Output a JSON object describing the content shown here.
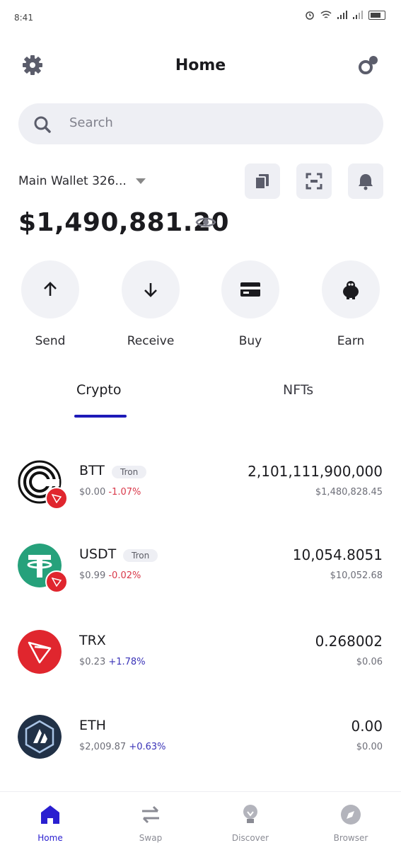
{
  "status_bar": {
    "time": "8:41"
  },
  "header": {
    "title": "Home"
  },
  "search": {
    "placeholder": "Search"
  },
  "wallet": {
    "name": "Main Wallet 326...",
    "balance": "$1,490,881.20"
  },
  "actions": [
    {
      "label": "Send",
      "icon": "arrow-up-icon"
    },
    {
      "label": "Receive",
      "icon": "arrow-down-icon"
    },
    {
      "label": "Buy",
      "icon": "card-icon"
    },
    {
      "label": "Earn",
      "icon": "earn-icon"
    }
  ],
  "tabs": [
    {
      "label": "Crypto",
      "active": true
    },
    {
      "label": "NFTs",
      "active": false
    }
  ],
  "assets": [
    {
      "symbol": "BTT",
      "tag": "Tron",
      "price": "$0.00",
      "change": "-1.07%",
      "amount": "2,101,111,900,000",
      "value": "$1,480,828.45"
    },
    {
      "symbol": "USDT",
      "tag": "Tron",
      "price": "$0.99",
      "change": "-0.02%",
      "amount": "10,054.8051",
      "value": "$10,052.68"
    },
    {
      "symbol": "TRX",
      "tag": "",
      "price": "$0.23",
      "change": "+1.78%",
      "amount": "0.268002",
      "value": "$0.06"
    },
    {
      "symbol": "ETH",
      "tag": "",
      "price": "$2,009.87",
      "change": "+0.63%",
      "amount": "0.00",
      "value": "$0.00"
    }
  ],
  "bottom_nav": [
    {
      "label": "Home",
      "active": true
    },
    {
      "label": "Swap",
      "active": false
    },
    {
      "label": "Discover",
      "active": false
    },
    {
      "label": "Browser",
      "active": false
    }
  ],
  "colors": {
    "accent": "#1d1ab8",
    "negative": "#d9394a",
    "positive": "#3a33b8",
    "tron": "#e0262e",
    "tether": "#26a17b"
  }
}
